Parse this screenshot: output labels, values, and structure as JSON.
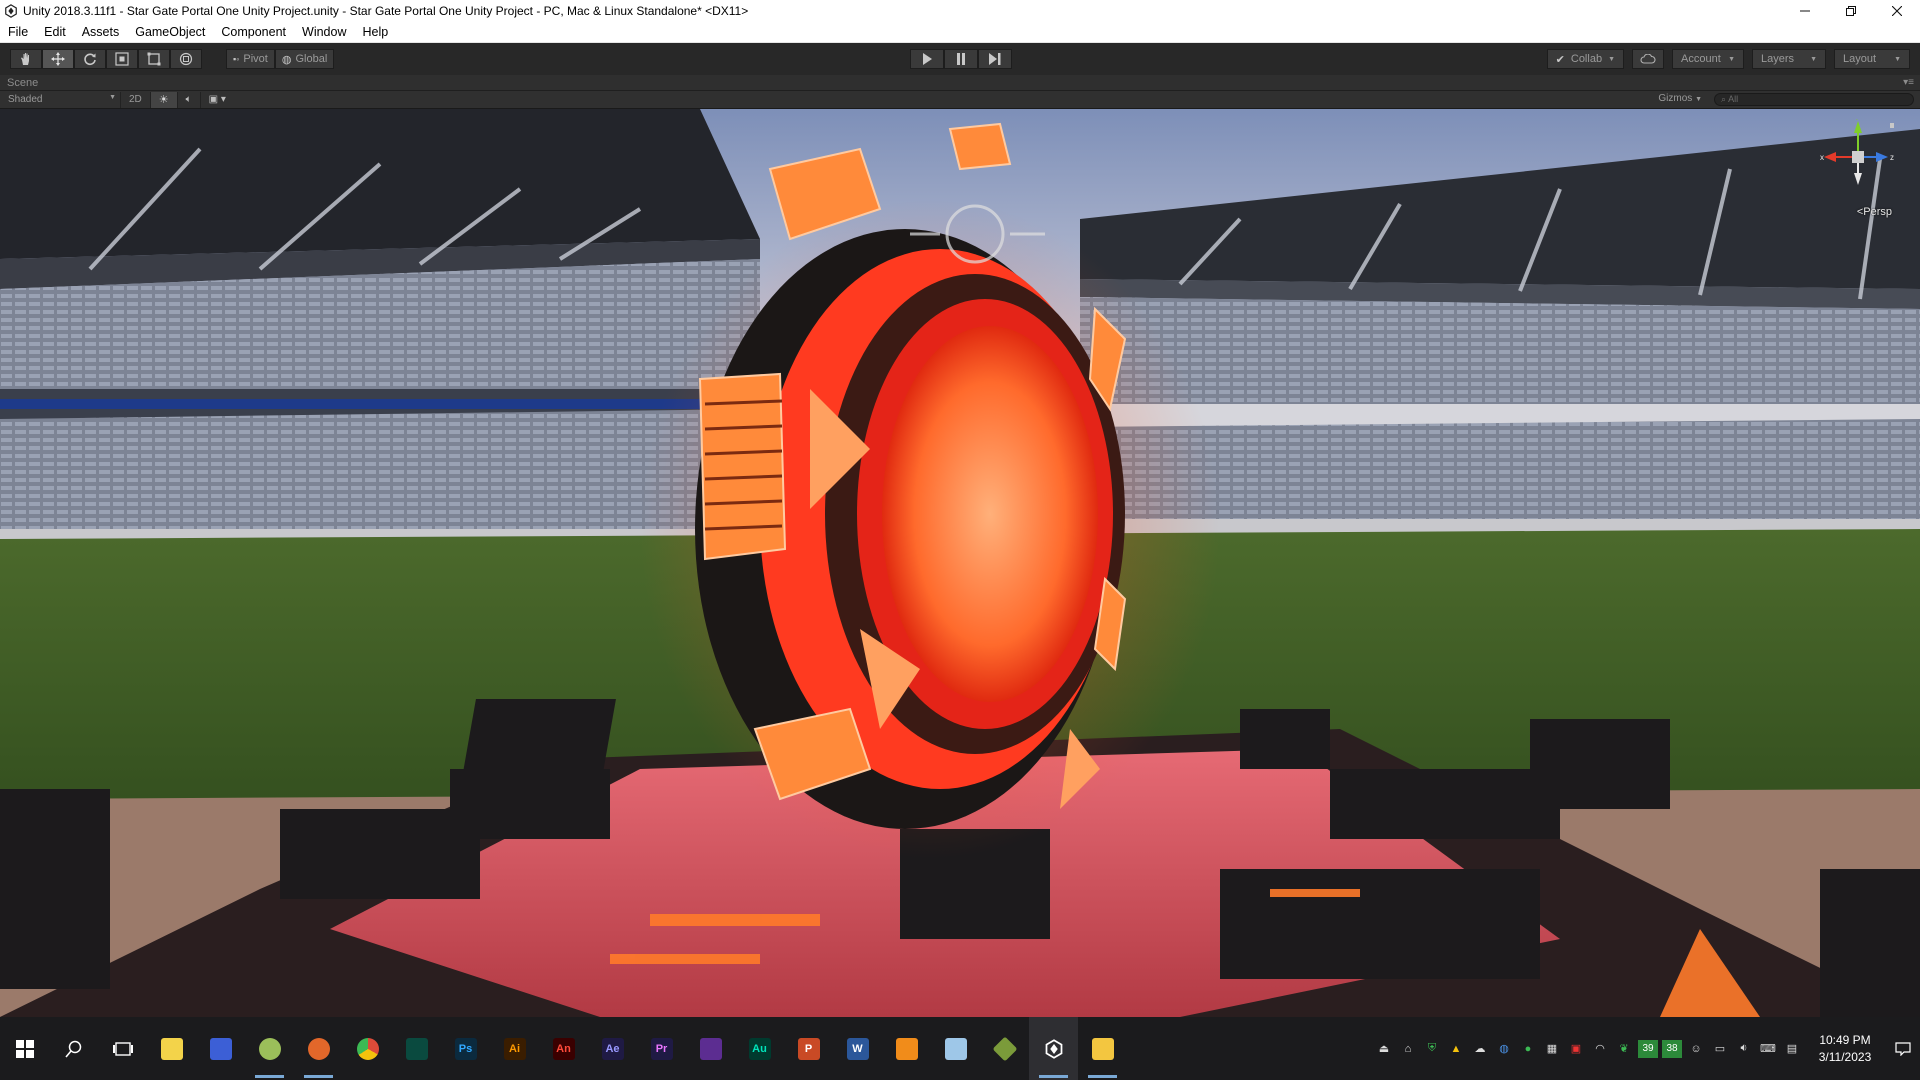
{
  "window": {
    "title": "Unity 2018.3.11f1 - Star Gate Portal One Unity Project.unity - Star Gate Portal One Unity Project - PC, Mac & Linux Standalone* <DX11>",
    "icon": "unity-logo-icon",
    "controls": {
      "minimize": "minimize-icon",
      "restore": "restore-icon",
      "close": "close-icon"
    }
  },
  "menu": {
    "items": [
      "File",
      "Edit",
      "Assets",
      "GameObject",
      "Component",
      "Window",
      "Help"
    ]
  },
  "toolbar": {
    "tools": [
      "hand-tool-icon",
      "move-tool-icon",
      "rotate-tool-icon",
      "scale-tool-icon",
      "rect-tool-icon",
      "transform-tool-icon"
    ],
    "active_tool": "move-tool-icon",
    "pivot_label": "Pivot",
    "global_label": "Global",
    "play_controls": [
      "play-icon",
      "pause-icon",
      "step-icon"
    ],
    "collab_label": "Collab",
    "cloud_icon": "cloud-icon",
    "account_label": "Account",
    "layers_label": "Layers",
    "layout_label": "Layout"
  },
  "scene": {
    "tab_label": "Scene",
    "shading_label": "Shaded",
    "mode_2d_label": "2D",
    "lighting_icon": "sun-icon",
    "audio_icon": "speaker-icon",
    "effects_icon": "image-effects-icon",
    "gizmos_label": "Gizmos",
    "search_placeholder": "All",
    "projection_label": "Persp",
    "axis_x": "x",
    "axis_y": "y",
    "axis_z": "z"
  },
  "taskbar": {
    "apps": [
      {
        "name": "start-icon",
        "glyph": "",
        "color": "#ffffff"
      },
      {
        "name": "search-icon",
        "glyph": "",
        "color": "#ffffff"
      },
      {
        "name": "task-view-icon",
        "glyph": "",
        "color": "#ffffff"
      },
      {
        "name": "sticky-notes-icon",
        "glyph": "",
        "color": "#f3d34a"
      },
      {
        "name": "azure-icon",
        "glyph": "",
        "color": "#3c5fd6"
      },
      {
        "name": "paint-icon",
        "glyph": "",
        "color": "#9bbf5a"
      },
      {
        "name": "firefox-icon",
        "glyph": "",
        "color": "#e2672a"
      },
      {
        "name": "chrome-icon",
        "glyph": "",
        "color": "#dd4b39"
      },
      {
        "name": "media-encoder-icon",
        "glyph": "",
        "color": "#0a4a3f"
      },
      {
        "name": "photoshop-icon",
        "glyph": "Ps",
        "color": "#0b2a3e"
      },
      {
        "name": "illustrator-icon",
        "glyph": "Ai",
        "color": "#3a1d00"
      },
      {
        "name": "animate-icon",
        "glyph": "An",
        "color": "#3a0000"
      },
      {
        "name": "after-effects-icon",
        "glyph": "Ae",
        "color": "#1f1a44"
      },
      {
        "name": "premiere-icon",
        "glyph": "Pr",
        "color": "#1f1a44"
      },
      {
        "name": "visual-studio-icon",
        "glyph": "",
        "color": "#5c2d91"
      },
      {
        "name": "audition-icon",
        "glyph": "Au",
        "color": "#003a2e"
      },
      {
        "name": "powerpoint-icon",
        "glyph": "P",
        "color": "#c94a25"
      },
      {
        "name": "word-icon",
        "glyph": "W",
        "color": "#2b579a"
      },
      {
        "name": "sublime-icon",
        "glyph": "",
        "color": "#f18c1a"
      },
      {
        "name": "notepad-icon",
        "glyph": "",
        "color": "#9ec7e8"
      },
      {
        "name": "winrar-icon",
        "glyph": "",
        "color": "#7b9b3a"
      },
      {
        "name": "unity-icon",
        "glyph": "",
        "color": "#ffffff"
      },
      {
        "name": "file-explorer-icon",
        "glyph": "",
        "color": "#f3c640"
      }
    ],
    "tray_badges": [
      "39",
      "38"
    ],
    "time": "10:49 PM",
    "date": "3/11/2023"
  }
}
